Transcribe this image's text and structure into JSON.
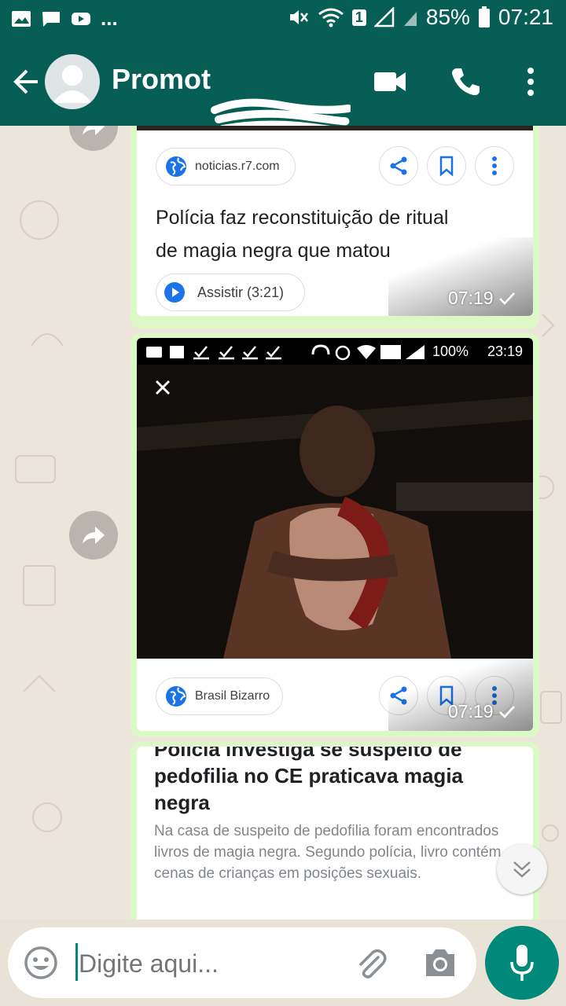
{
  "status_bar": {
    "battery": "85%",
    "time": "07:21",
    "sim_badge": "1",
    "overflow": "..."
  },
  "header": {
    "contact_name": "Promot"
  },
  "messages": [
    {
      "source": "noticias.r7.com",
      "headline": "Polícia faz reconstituição de ritual de magia negra que matou",
      "play_label": "Assistir (3:21)",
      "time": "07:19"
    },
    {
      "embedded_status": {
        "battery": "100%",
        "time": "23:19"
      },
      "source": "Brasil Bizarro",
      "time": "07:19"
    },
    {
      "headline": "Polícia investiga se suspeito de pedofilia no CE praticava magia negra",
      "snippet": "Na casa de suspeito de pedofilia foram encontrados livros de magia negra. Segundo polícia, livro contém cenas de crianças em posições sexuais."
    }
  ],
  "composer": {
    "placeholder": "Digite aqui..."
  },
  "colors": {
    "header": "#075e54",
    "bubble": "#dcf8c6",
    "mic": "#00897b",
    "link_blue": "#1a73e8"
  }
}
